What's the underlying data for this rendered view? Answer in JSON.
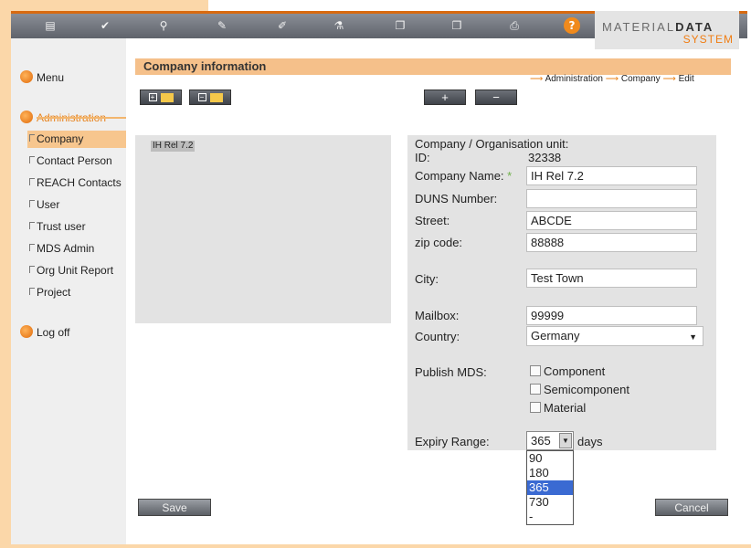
{
  "toolbar": {
    "icons": [
      "save-icon",
      "check-icon",
      "search-icon",
      "edit-icon",
      "pencil-icon",
      "flask-icon",
      "copy-icon",
      "paste-icon",
      "print-icon",
      "help-icon"
    ],
    "glyphs": [
      "▤",
      "✔",
      "⚲",
      "✎",
      "✐",
      "⚗",
      "❐",
      "❐",
      "⎙",
      "?"
    ]
  },
  "brand": {
    "top_left": "MATERIAL",
    "top_right": "DATA",
    "bottom": "SYSTEM"
  },
  "sidebar": {
    "menu": "Menu",
    "administration": "Administration",
    "items": [
      "Company",
      "Contact Person",
      "REACH Contacts",
      "User",
      "Trust user",
      "MDS Admin",
      "Org Unit Report",
      "Project"
    ],
    "logoff": "Log off"
  },
  "main": {
    "title": "Company information",
    "breadcrumb": [
      "Administration",
      "Company",
      "Edit"
    ],
    "add_label": "+",
    "remove_label": "−",
    "tree_node": "IH Rel 7.2"
  },
  "form": {
    "org_unit_label": "Company / Organisation unit:",
    "id_label": "ID:",
    "id_value": "32338",
    "company_name_label": "Company Name:",
    "required_mark": "*",
    "company_name": "IH Rel 7.2",
    "duns_label": "DUNS Number:",
    "duns": "",
    "street_label": "Street:",
    "street": "ABCDE",
    "zip_label": "zip code:",
    "zip": "88888",
    "city_label": "City:",
    "city": "Test Town",
    "mailbox_label": "Mailbox:",
    "mailbox": "99999",
    "country_label": "Country:",
    "country": "Germany",
    "publish_label": "Publish MDS:",
    "publish_options": [
      "Component",
      "Semicomponent",
      "Material"
    ],
    "expiry_label": "Expiry Range:",
    "expiry_value": "365",
    "expiry_unit": "days",
    "expiry_options": [
      "90",
      "180",
      "365",
      "730",
      "-"
    ]
  },
  "buttons": {
    "save": "Save",
    "cancel": "Cancel"
  },
  "colors": {
    "accent": "#f07d12",
    "title_bar": "#f5c08a",
    "active_item": "#f7c68e",
    "selected_option": "#3a6ad2"
  }
}
